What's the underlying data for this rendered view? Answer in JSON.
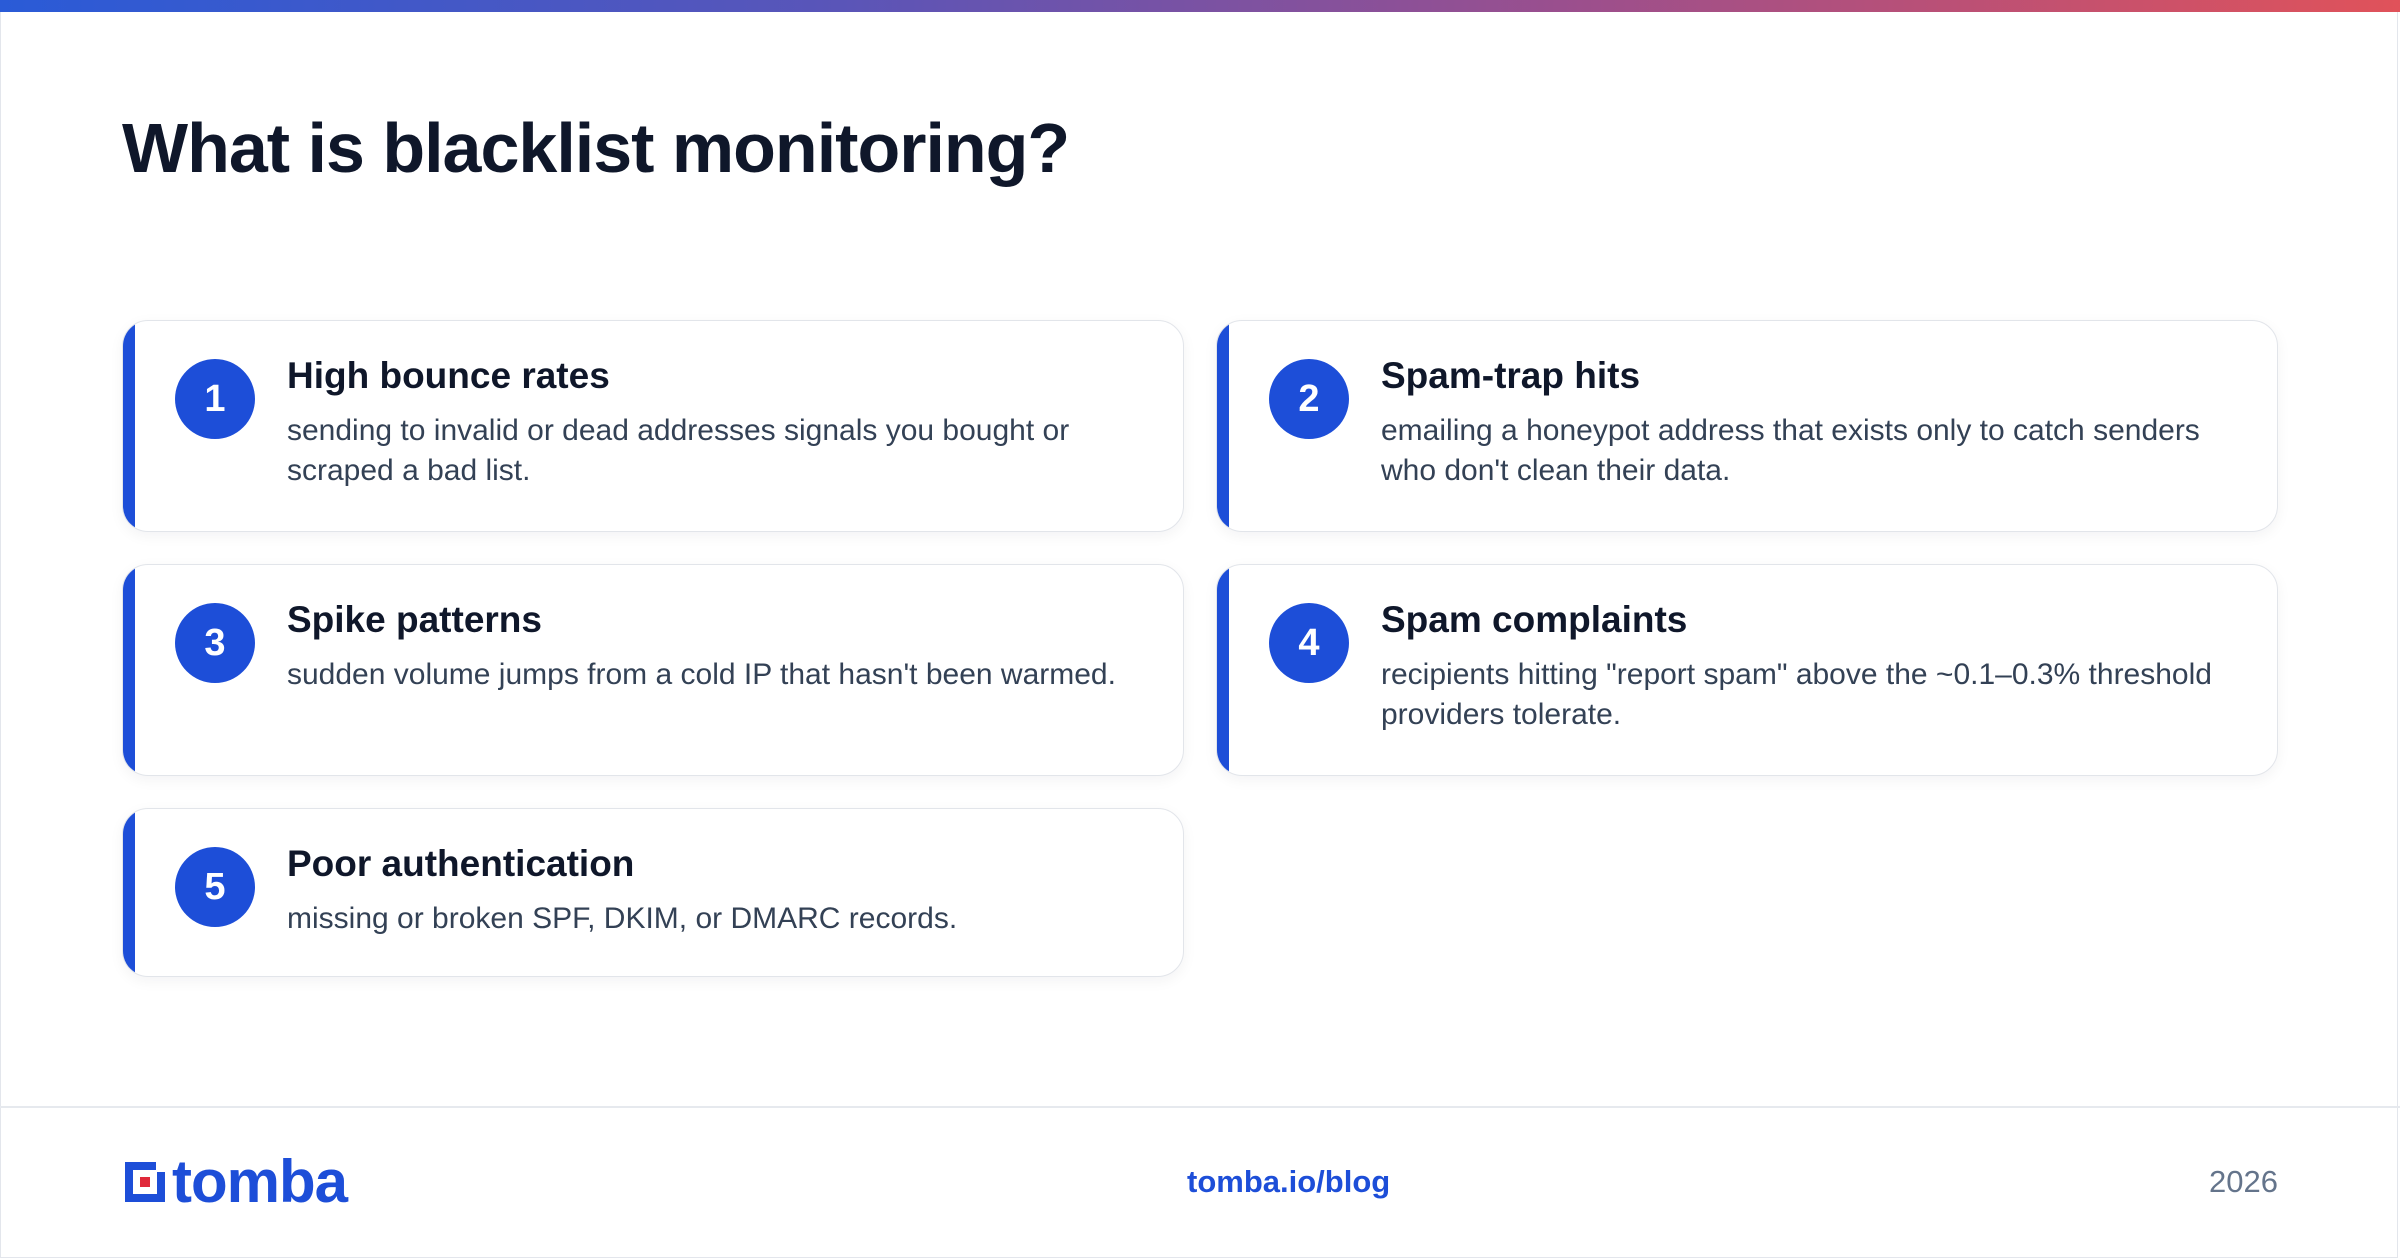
{
  "title": "What is blacklist monitoring?",
  "items": [
    {
      "number": "1",
      "title": "High bounce rates",
      "description": "sending to invalid or dead addresses signals you bought or scraped a bad list."
    },
    {
      "number": "2",
      "title": "Spam-trap hits",
      "description": "emailing a honeypot address that exists only to catch senders who don't clean their data."
    },
    {
      "number": "3",
      "title": "Spike patterns",
      "description": "sudden volume jumps from a cold IP that hasn't been warmed."
    },
    {
      "number": "4",
      "title": "Spam complaints",
      "description": "recipients hitting \"report spam\" above the ~0.1–0.3% threshold providers tolerate."
    },
    {
      "number": "5",
      "title": "Poor authentication",
      "description": "missing or broken SPF, DKIM, or DMARC records."
    }
  ],
  "footer": {
    "logo_text": "tomba",
    "link": "tomba.io/blog",
    "year": "2026"
  },
  "colors": {
    "accent": "#1d4ed8",
    "logo_red": "#e0293a",
    "heading": "#0f172a",
    "body_text": "#334155"
  }
}
